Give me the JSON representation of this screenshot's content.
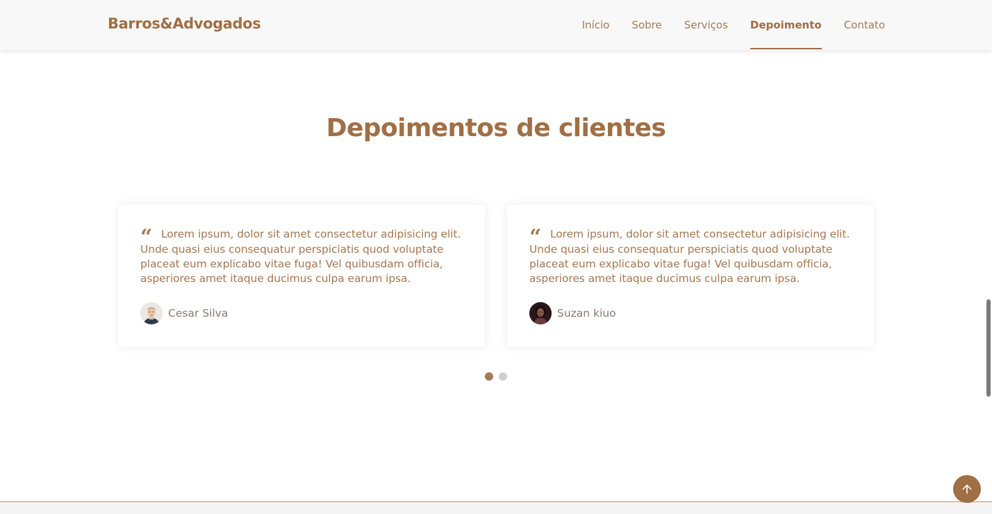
{
  "header": {
    "logo": "Barros&Advogados",
    "nav": [
      {
        "label": "Início",
        "active": false
      },
      {
        "label": "Sobre",
        "active": false
      },
      {
        "label": "Serviços",
        "active": false
      },
      {
        "label": "Depoimento",
        "active": true
      },
      {
        "label": "Contato",
        "active": false
      }
    ]
  },
  "testimonials": {
    "title": "Depoimentos de clientes",
    "items": [
      {
        "text": "Lorem ipsum, dolor sit amet consectetur adipisicing elit. Unde quasi eius consequatur perspiciatis quod voluptate placeat eum explicabo vitae fuga! Vel quibusdam officia, asperiores amet itaque ducimus culpa earum ipsa.",
        "author": "Cesar Silva",
        "avatar_icon": "man-avatar"
      },
      {
        "text": "Lorem ipsum, dolor sit amet consectetur adipisicing elit. Unde quasi eius consequatur perspiciatis quod voluptate placeat eum explicabo vitae fuga! Vel quibusdam officia, asperiores amet itaque ducimus culpa earum ipsa.",
        "author": "Suzan kiuo",
        "avatar_icon": "woman-avatar"
      }
    ],
    "pagination": {
      "pages": 2,
      "current": 1
    }
  },
  "colors": {
    "brand": "#a06f45",
    "text_muted": "#8a7a6f",
    "dot_inactive": "#d0d0d0"
  },
  "back_to_top_icon": "arrow-up-icon"
}
